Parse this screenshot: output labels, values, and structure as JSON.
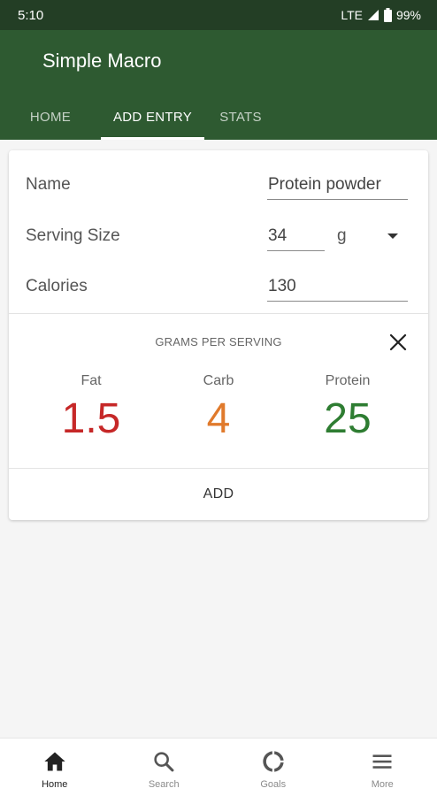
{
  "status_bar": {
    "time": "5:10",
    "network": "LTE",
    "battery": "99%"
  },
  "app": {
    "title": "Simple Macro"
  },
  "tabs": [
    {
      "label": "HOME",
      "active": false
    },
    {
      "label": "ADD ENTRY",
      "active": true
    },
    {
      "label": "STATS",
      "active": false
    }
  ],
  "form": {
    "name": {
      "label": "Name",
      "value": "Protein powder"
    },
    "serving_size": {
      "label": "Serving Size",
      "value": "34",
      "unit": "g"
    },
    "calories": {
      "label": "Calories",
      "value": "130"
    }
  },
  "grams_per_serving": {
    "title": "GRAMS PER SERVING",
    "fat": {
      "label": "Fat",
      "value": "1.5",
      "color": "#c62828"
    },
    "carb": {
      "label": "Carb",
      "value": "4",
      "color": "#e07a2c"
    },
    "protein": {
      "label": "Protein",
      "value": "25",
      "color": "#2e7d32"
    }
  },
  "add_label": "ADD",
  "bottom_nav": [
    {
      "label": "Home",
      "icon": "home-icon",
      "active": true
    },
    {
      "label": "Search",
      "icon": "search-icon",
      "active": false
    },
    {
      "label": "Goals",
      "icon": "goals-icon",
      "active": false
    },
    {
      "label": "More",
      "icon": "menu-icon",
      "active": false
    }
  ],
  "colors": {
    "primary": "#2e5a31",
    "primary_dark": "#233e25"
  }
}
